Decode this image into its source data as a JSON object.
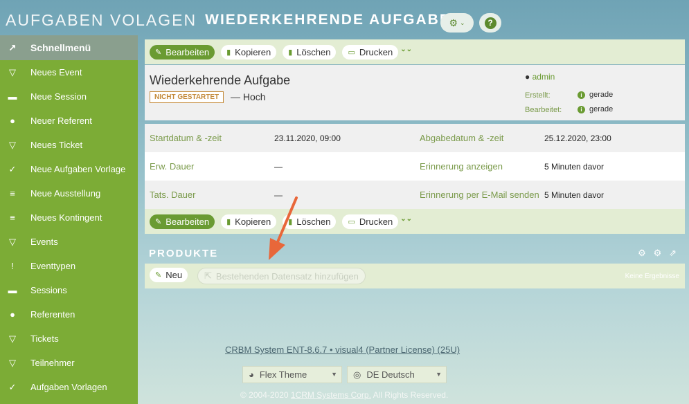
{
  "header": {
    "title_light": "AUFGABEN VOLAGEN",
    "title_bold": "WIEDERKEHRENDE AUFGABE"
  },
  "sidebar": {
    "top_label": "Schnellmenü",
    "items": [
      {
        "label": "Neues Event",
        "icon": "event-icon"
      },
      {
        "label": "Neue Session",
        "icon": "session-icon"
      },
      {
        "label": "Neuer Referent",
        "icon": "person-icon"
      },
      {
        "label": "Neues Ticket",
        "icon": "ticket-icon"
      },
      {
        "label": "Neue Aufgaben Vorlage",
        "icon": "check-icon"
      },
      {
        "label": "Neue Ausstellung",
        "icon": "list-icon"
      },
      {
        "label": "Neues Kontingent",
        "icon": "list-icon"
      },
      {
        "label": "Events",
        "icon": "event-icon"
      },
      {
        "label": "Eventtypen",
        "icon": "pin-icon"
      },
      {
        "label": "Sessions",
        "icon": "session-icon"
      },
      {
        "label": "Referenten",
        "icon": "person-icon"
      },
      {
        "label": "Tickets",
        "icon": "ticket-icon"
      },
      {
        "label": "Teilnehmer",
        "icon": "ticket-icon"
      },
      {
        "label": "Aufgaben Vorlagen",
        "icon": "check-icon"
      }
    ]
  },
  "toolbar": {
    "edit": "Bearbeiten",
    "copy": "Kopieren",
    "delete": "Löschen",
    "print": "Drucken"
  },
  "record": {
    "title": "Wiederkehrende Aufgabe",
    "status": "NICHT GESTARTET",
    "priority": "— Hoch",
    "user": "admin",
    "created_label": "Erstellt:",
    "created_value": "gerade",
    "edited_label": "Bearbeitet:",
    "edited_value": "gerade"
  },
  "details": {
    "rows": [
      {
        "l1": "Startdatum & -zeit",
        "v1": "23.11.2020, 09:00",
        "l2": "Abgabedatum & -zeit",
        "v2": "25.12.2020, 23:00"
      },
      {
        "l1": "Erw. Dauer",
        "v1": "—",
        "l2": "Erinnerung anzeigen",
        "v2": "5 Minuten davor"
      },
      {
        "l1": "Tats. Dauer",
        "v1": "—",
        "l2": "Erinnerung per E-Mail senden",
        "v2": "5 Minuten davor"
      }
    ]
  },
  "products": {
    "title": "PRODUKTE",
    "new_label": "Neu",
    "add_existing_label": "Bestehenden Datensatz hinzufügen",
    "no_results": "Keine Ergebnisse"
  },
  "footer": {
    "version": "CRBM System ENT-8.6.7 • visual4 (Partner License) (25U)",
    "theme_select": "Flex Theme",
    "language_select": "DE Deutsch",
    "copyright_prefix": "© 2004-2020",
    "copyright_link": "1CRM Systems Corp.",
    "copyright_suffix": "All Rights Reserved."
  },
  "colors": {
    "sidebar_green": "#7cac36",
    "accent_green": "#6a9b32",
    "status_orange": "#c48a3a",
    "annotation_arrow": "#e8673a"
  }
}
